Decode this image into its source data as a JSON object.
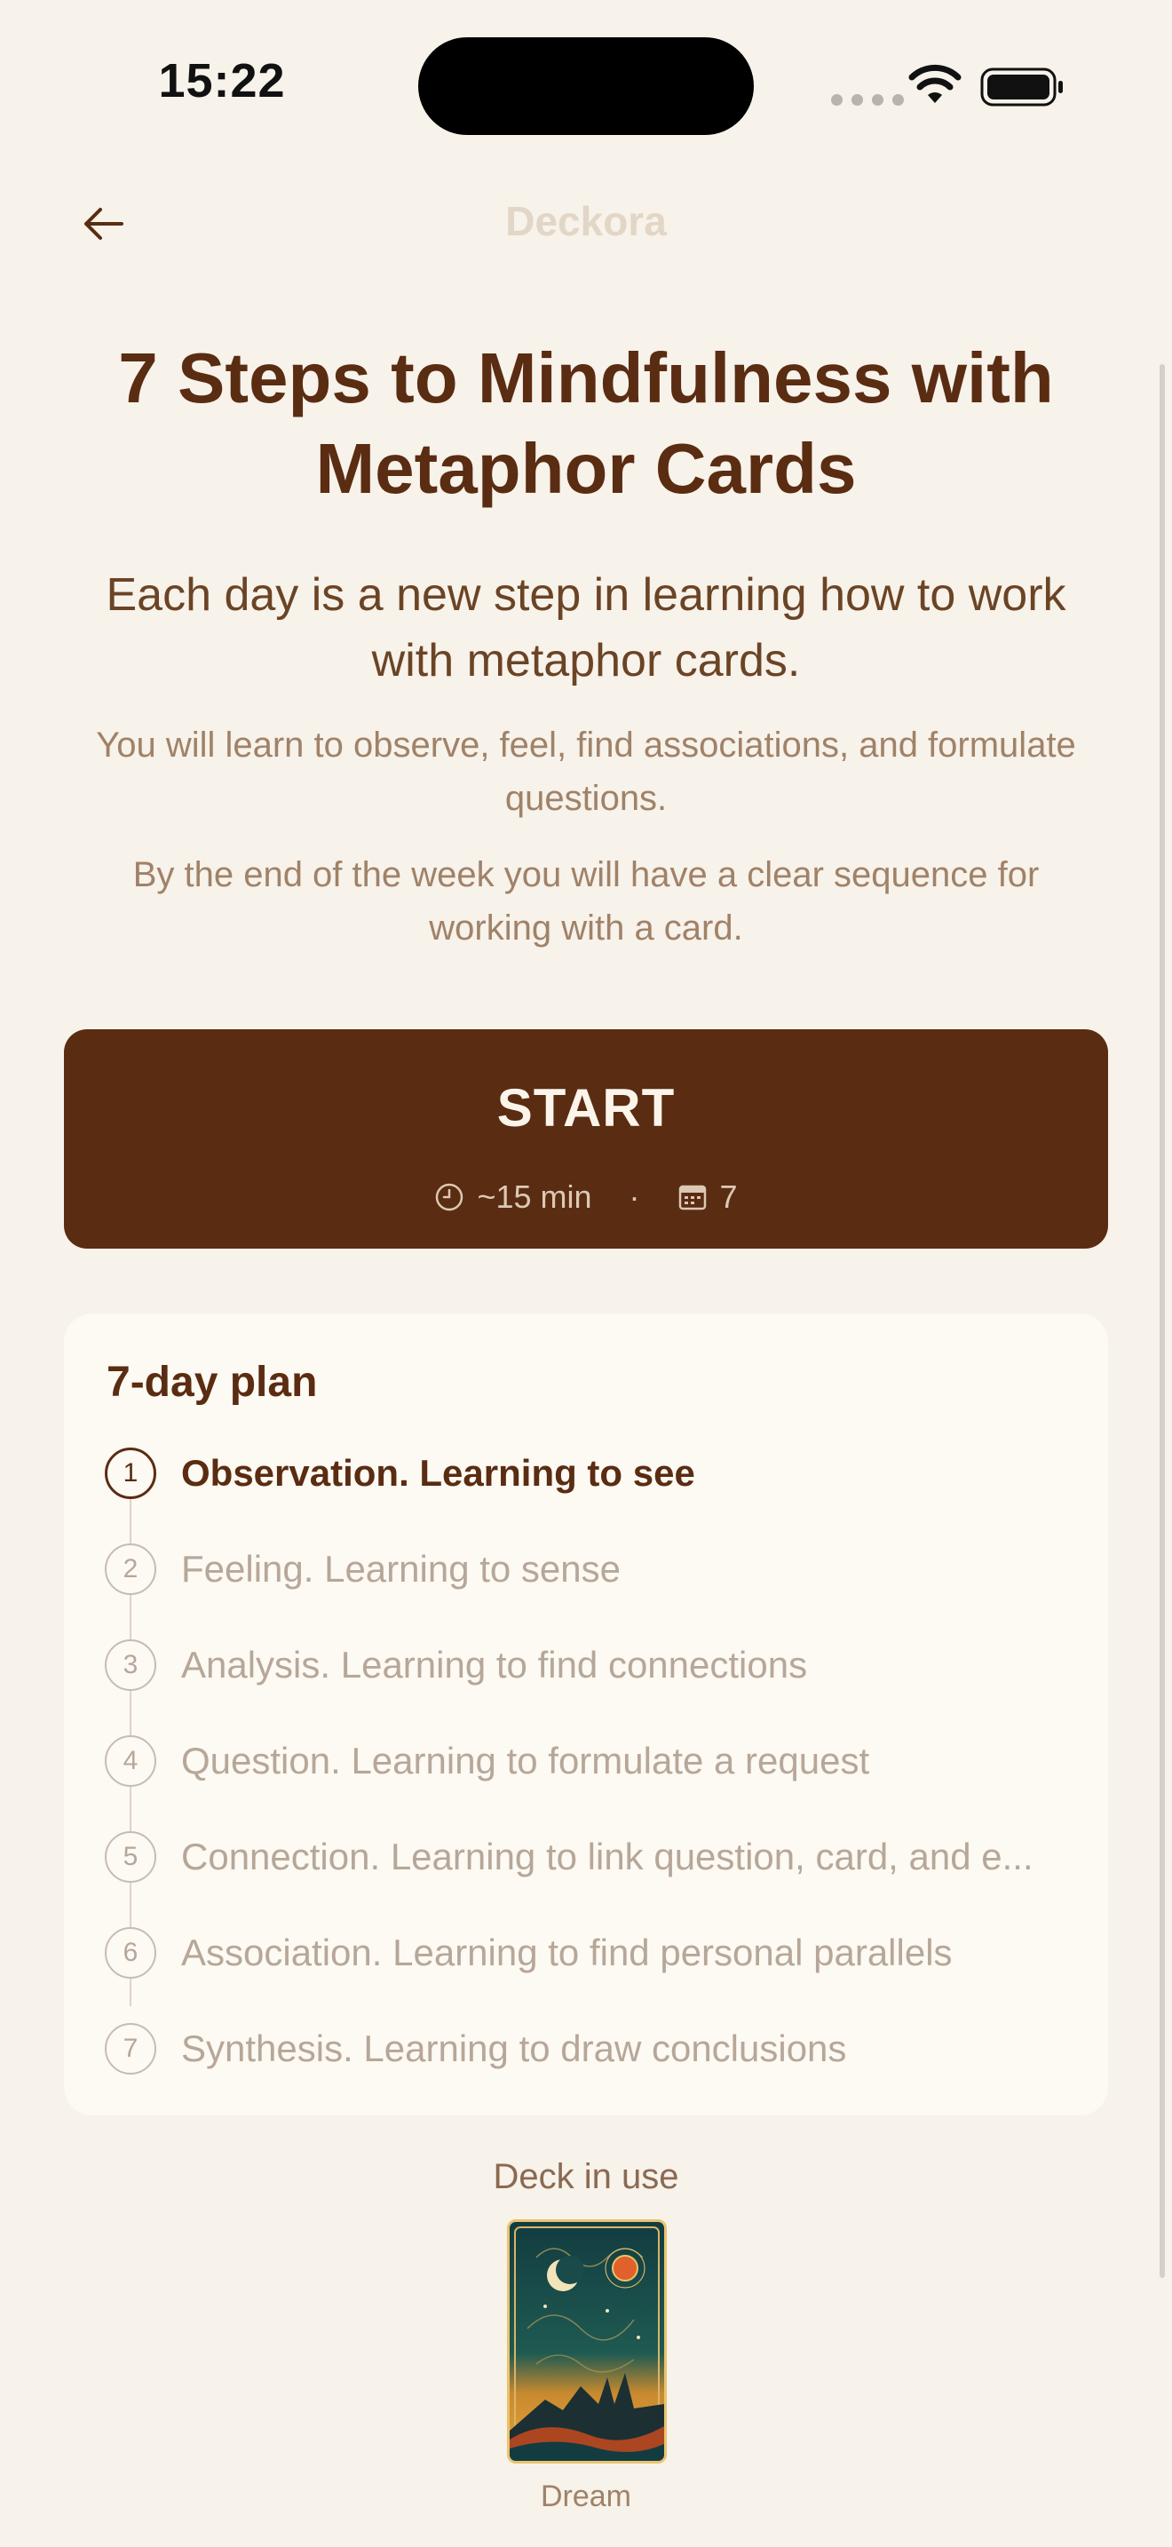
{
  "status_bar": {
    "time": "15:22"
  },
  "nav": {
    "title": "Deckora",
    "back_icon": "arrow-left-icon"
  },
  "main": {
    "title": "7 Steps to Mindfulness with Metaphor Cards",
    "lead": "Each day is a new step in learning how to work with metaphor cards.",
    "body_1": "You will learn to observe, feel, find associations, and formulate questions.",
    "body_2": "By the end of the week you will have a clear sequence for working with a card."
  },
  "start_button": {
    "label": "START",
    "duration": "~15 min",
    "separator": "·",
    "days": "7",
    "duration_icon": "clock-icon",
    "days_icon": "calendar-icon"
  },
  "plan": {
    "title": "7-day plan",
    "active_step": 1,
    "steps": [
      {
        "number": "1",
        "label": "Observation. Learning to see"
      },
      {
        "number": "2",
        "label": "Feeling. Learning to sense"
      },
      {
        "number": "3",
        "label": "Analysis. Learning to find connections"
      },
      {
        "number": "4",
        "label": "Question. Learning to formulate a request"
      },
      {
        "number": "5",
        "label": "Connection. Learning to link question, card, and e..."
      },
      {
        "number": "6",
        "label": "Association. Learning to find personal parallels"
      },
      {
        "number": "7",
        "label": "Synthesis. Learning to draw conclusions"
      }
    ]
  },
  "deck": {
    "heading": "Deck in use",
    "name": "Dream"
  },
  "colors": {
    "background": "#f7f2ea",
    "accent": "#5a2c12",
    "muted_text": "#a08268",
    "card_background": "#fdf9f3"
  }
}
